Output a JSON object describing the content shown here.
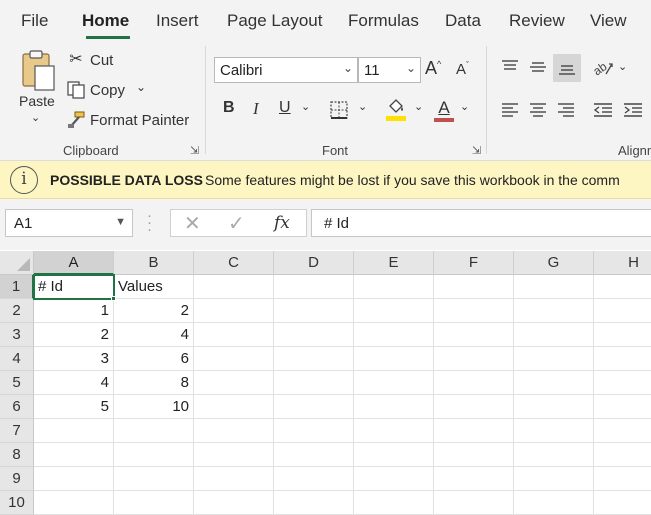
{
  "menu": {
    "tabs": [
      "File",
      "Home",
      "Insert",
      "Page Layout",
      "Formulas",
      "Data",
      "Review",
      "View"
    ],
    "active_tab": "Home",
    "accent": "#217346"
  },
  "ribbon": {
    "clipboard": {
      "paste": "Paste",
      "cut": "Cut",
      "copy": "Copy",
      "format_painter": "Format Painter",
      "label": "Clipboard"
    },
    "font": {
      "font_name": "Calibri",
      "font_size": "11",
      "bold": "B",
      "italic": "I",
      "underline": "U",
      "font_color_glyph": "A",
      "grow_glyph": "A",
      "shrink_glyph": "A",
      "label": "Font",
      "highlight_color": "#ffe000",
      "font_color": "#c0504d"
    },
    "alignment": {
      "label": "Alignm"
    }
  },
  "infobar": {
    "title": "POSSIBLE DATA LOSS",
    "message": "Some features might be lost if you save this workbook in the comm"
  },
  "formula_bar": {
    "name_box": "A1",
    "cancel": "✕",
    "enter": "✓",
    "fx": "fx",
    "content": "# Id"
  },
  "sheet": {
    "columns": [
      "A",
      "B",
      "C",
      "D",
      "E",
      "F",
      "G",
      "H"
    ],
    "rows": [
      "1",
      "2",
      "3",
      "4",
      "5",
      "6",
      "7",
      "8",
      "9",
      "10"
    ],
    "active_cell": "A1",
    "cells": {
      "A1": "# Id",
      "B1": "Values",
      "A2": "1",
      "B2": "2",
      "A3": "2",
      "B3": "4",
      "A4": "3",
      "B4": "6",
      "A5": "4",
      "B5": "8",
      "A6": "5",
      "B6": "10"
    }
  }
}
